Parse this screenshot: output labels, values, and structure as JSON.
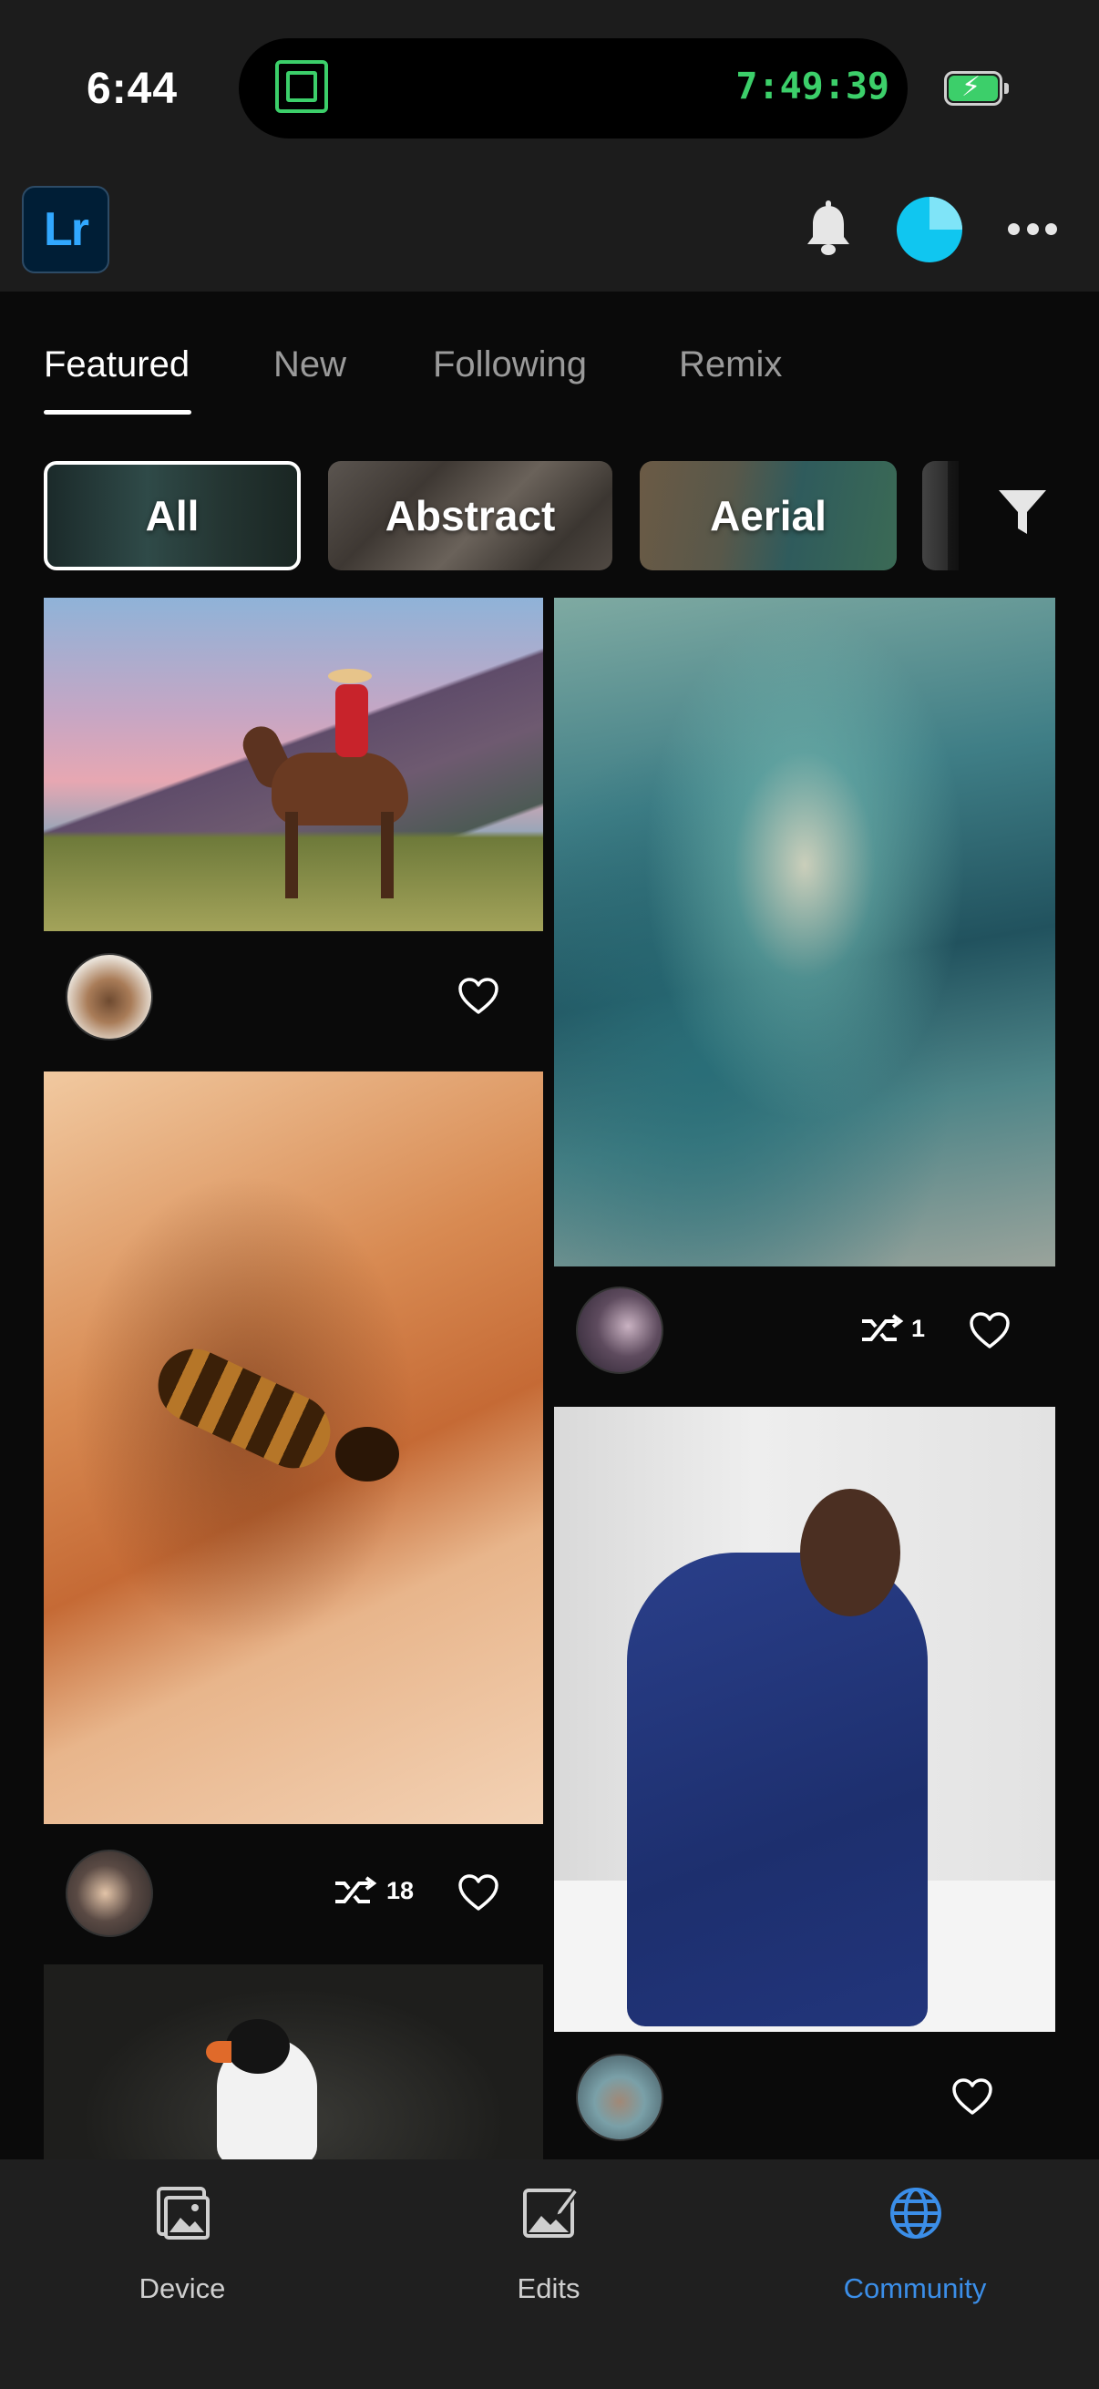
{
  "status_bar": {
    "time": "6:44",
    "live_activity_timer": "7:49:39"
  },
  "app": {
    "logo_text": "Lr",
    "accent_color": "#3b8ee8"
  },
  "tabs": [
    {
      "label": "Featured",
      "active": true
    },
    {
      "label": "New",
      "active": false
    },
    {
      "label": "Following",
      "active": false
    },
    {
      "label": "Remix",
      "active": false
    }
  ],
  "filter_chips": [
    {
      "label": "All",
      "selected": true
    },
    {
      "label": "Abstract",
      "selected": false
    },
    {
      "label": "Aerial",
      "selected": false
    }
  ],
  "feed": {
    "posts": [
      {
        "subject": "cowboy on horse",
        "remix_count": null,
        "liked": false
      },
      {
        "subject": "abstract glass",
        "remix_count": "1",
        "liked": false
      },
      {
        "subject": "bee on sand",
        "remix_count": "18",
        "liked": false
      },
      {
        "subject": "woman in pinstripe suit",
        "remix_count": null,
        "liked": false
      },
      {
        "subject": "puffin",
        "remix_count": null,
        "liked": false
      }
    ]
  },
  "bottom_nav": [
    {
      "label": "Device",
      "icon": "photo-device-icon",
      "active": false
    },
    {
      "label": "Edits",
      "icon": "photo-edit-icon",
      "active": false
    },
    {
      "label": "Community",
      "icon": "globe-icon",
      "active": true
    }
  ]
}
